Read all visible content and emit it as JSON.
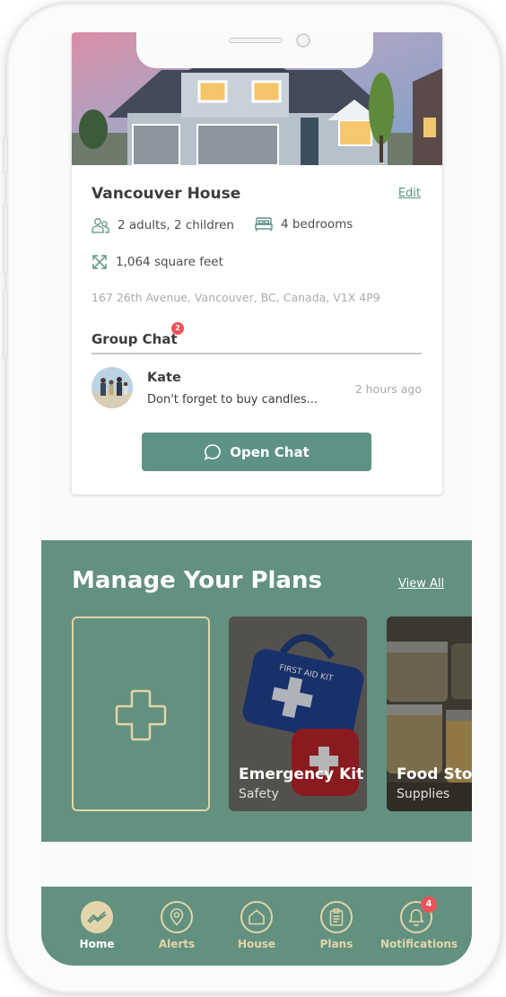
{
  "house": {
    "name": "Vancouver House",
    "edit_label": "Edit",
    "occupants": "2 adults, 2 children",
    "bedrooms": "4 bedrooms",
    "area": "1,064 square feet",
    "address": "167 26th Avenue, Vancouver, BC, Canada, V1X 4P9"
  },
  "group_chat": {
    "title": "Group Chat",
    "unread_count": "2",
    "last_message": {
      "sender": "Kate",
      "text": "Don't forget to buy candles...",
      "time": "2 hours ago"
    },
    "open_button_label": "Open Chat"
  },
  "plans": {
    "title": "Manage Your Plans",
    "view_all_label": "View All",
    "items": [
      {
        "name": "Emergency Kit",
        "category": "Safety"
      },
      {
        "name": "Food Stock",
        "category": "Supplies"
      }
    ]
  },
  "nav": {
    "items": [
      {
        "label": "Home",
        "icon": "home-trend-icon",
        "active": true
      },
      {
        "label": "Alerts",
        "icon": "location-pin-icon",
        "active": false
      },
      {
        "label": "House",
        "icon": "house-icon",
        "active": false
      },
      {
        "label": "Plans",
        "icon": "clipboard-icon",
        "active": false
      },
      {
        "label": "Notifications",
        "icon": "bell-icon",
        "active": false,
        "badge": "4"
      }
    ]
  },
  "colors": {
    "accent_green": "#5d9285",
    "section_green": "#62917f",
    "cream": "#e3d5a9",
    "badge_red": "#ef5258"
  }
}
